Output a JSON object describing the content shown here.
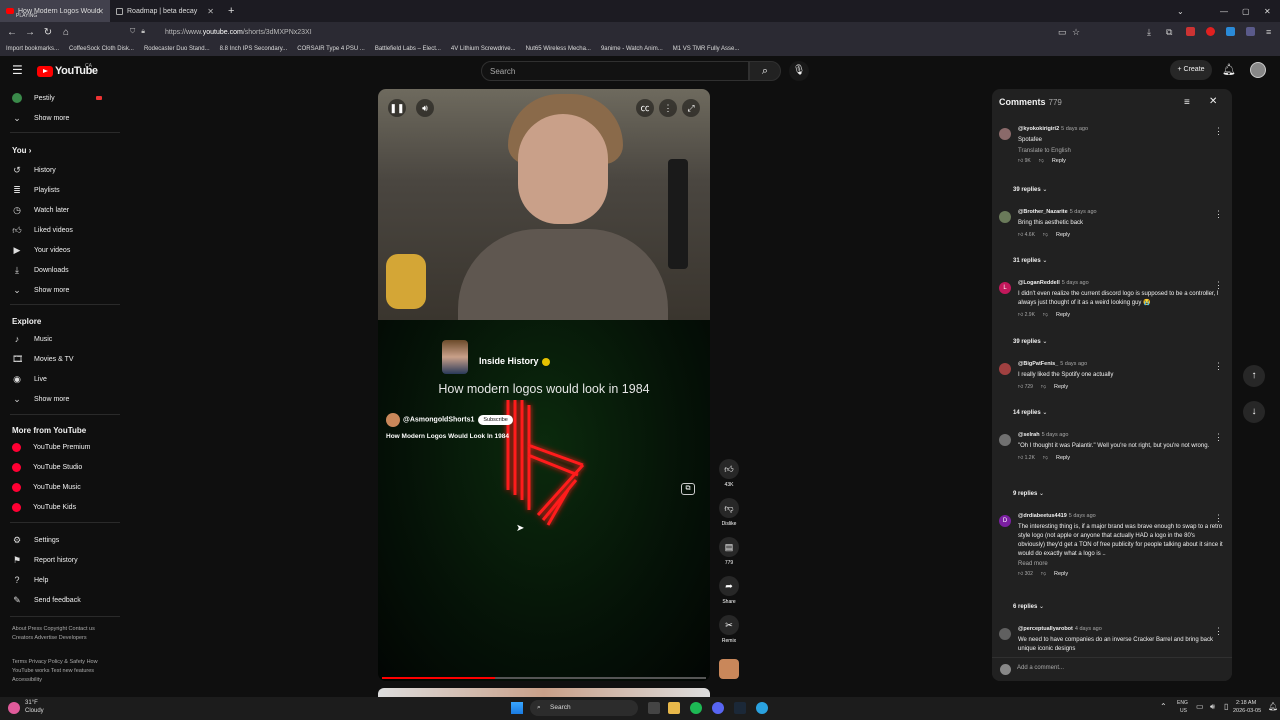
{
  "browser": {
    "tabs": [
      {
        "title": "How Modern Logos Would Loo",
        "subtitle": "PLAYING"
      },
      {
        "title": "Roadmap | beta decay"
      }
    ],
    "url_prefix": "https://www.",
    "url_domain": "youtube.com",
    "url_path": "/shorts/3dMXPNx23XI",
    "bookmarks": [
      "Import bookmarks...",
      "CoffeeSock Cloth Disk...",
      "Rodecaster Duo Stand...",
      "8.8 Inch IPS Secondary...",
      "CORSAIR Type 4 PSU ...",
      "Battlefield Labs – Elect...",
      "4V Lithium Screwdrive...",
      "Nut65 Wireless Mecha...",
      "9anime - Watch Anim...",
      "M1 VS TMR Fully Asse..."
    ]
  },
  "header": {
    "logo_text": "YouTube",
    "logo_region": "CA",
    "search_placeholder": "Search",
    "create_label": "Create"
  },
  "sidebar": {
    "top_items": [
      {
        "label": "Pestily"
      },
      {
        "label": "Show more"
      }
    ],
    "you_heading": "You",
    "you_items": [
      {
        "label": "History"
      },
      {
        "label": "Playlists"
      },
      {
        "label": "Watch later"
      },
      {
        "label": "Liked videos"
      },
      {
        "label": "Your videos"
      },
      {
        "label": "Downloads"
      },
      {
        "label": "Show more"
      }
    ],
    "explore_heading": "Explore",
    "explore_items": [
      {
        "label": "Music"
      },
      {
        "label": "Movies & TV"
      },
      {
        "label": "Live"
      },
      {
        "label": "Show more"
      }
    ],
    "more_heading": "More from YouTube",
    "more_items": [
      {
        "label": "YouTube Premium"
      },
      {
        "label": "YouTube Studio"
      },
      {
        "label": "YouTube Music"
      },
      {
        "label": "YouTube Kids"
      }
    ],
    "settings_items": [
      {
        "label": "Settings"
      },
      {
        "label": "Report history"
      },
      {
        "label": "Help"
      },
      {
        "label": "Send feedback"
      }
    ],
    "footer_1": "About  Press  Copyright  Contact us  Creators  Advertise  Developers",
    "footer_2": "Terms  Privacy  Policy & Safety  How YouTube works  Test new features  Accessibility"
  },
  "video": {
    "channel_in_clip": "Inside History",
    "clip_title": "How modern logos would look in 1984",
    "owner": "@AsmongoldShorts1",
    "subscribe_label": "Subscribe",
    "title": "How Modern Logos Would Look In 1984",
    "progress": 0.35
  },
  "actions": {
    "likes": "43K",
    "dislike": "Dislike",
    "comments": "779",
    "share": "Share",
    "remix": "Remix"
  },
  "comments": {
    "heading": "Comments",
    "count": "779",
    "items": [
      {
        "user": "@kyokokirigiri2",
        "time": "5 days ago",
        "text": "Spotafee",
        "translate": "Translate to English",
        "likes": "9K",
        "replies": "39 replies",
        "color": "#8a6a6a"
      },
      {
        "user": "@Brother_Nazarite",
        "time": "5 days ago",
        "text": "Bring this aesthetic back",
        "likes": "4.6K",
        "replies": "31 replies",
        "color": "#6a7a5a"
      },
      {
        "user": "@LoganReddell",
        "time": "5 days ago",
        "text": "I didn't even realize the current discord logo is supposed to be a controller, I always just thought of it as a weird looking guy 😭",
        "likes": "2.9K",
        "replies": "39 replies",
        "color": "#c2185b",
        "initial": "L"
      },
      {
        "user": "@BigPatFenis_",
        "time": "5 days ago",
        "text": "I really liked the Spotify one actually",
        "likes": "729",
        "replies": "14 replies",
        "color": "#a04040"
      },
      {
        "user": "@selrah",
        "time": "5 days ago",
        "text": "\"Oh I thought it was Palantir.\" Well you're not right, but you're not wrong.",
        "likes": "1.2K",
        "replies": "9 replies",
        "color": "#707070"
      },
      {
        "user": "@drdiabeetus4419",
        "time": "5 days ago",
        "text": "The interesting thing is, if a major brand was brave enough to swap to a retro style logo (not apple or anyone that actually HAD a logo in the 80's obviously) they'd get a TON of free publicity for people talking about it since it would do exactly what a logo is ..",
        "readmore": "Read more",
        "likes": "302",
        "replies": "6 replies",
        "color": "#7b1fa2",
        "initial": "D"
      },
      {
        "user": "@perceptuallyarobot",
        "time": "4 days ago",
        "text": "We need to have companies do an inverse Cracker Barrel and bring back unique iconic designs",
        "color": "#606060"
      }
    ],
    "reply_label": "Reply",
    "add_placeholder": "Add a comment..."
  },
  "taskbar": {
    "weather_temp": "31°F",
    "weather_desc": "Cloudy",
    "search": "Search",
    "lang": "ENG",
    "region": "US",
    "time": "2:18 AM",
    "date": "2026-03-05"
  }
}
